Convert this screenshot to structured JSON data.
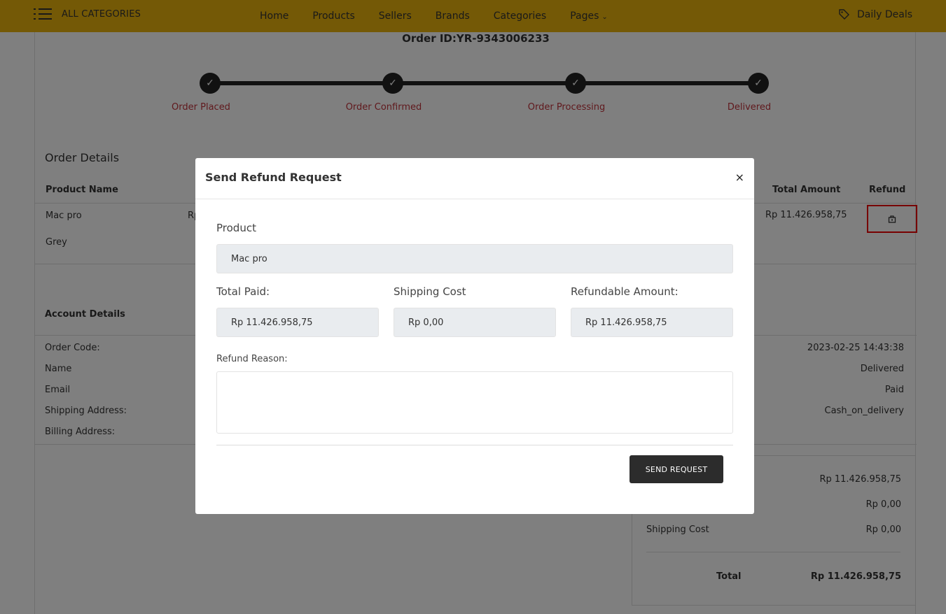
{
  "nav": {
    "categories_label": "ALL CATEGORIES",
    "menu": [
      "Home",
      "Products",
      "Sellers",
      "Brands",
      "Categories",
      "Pages"
    ],
    "daily_deals": "Daily Deals"
  },
  "order": {
    "id_text": "Order ID:YR-9343006233",
    "steps": [
      "Order Placed",
      "Order Confirmed",
      "Order Processing",
      "Delivered"
    ]
  },
  "order_details": {
    "title": "Order Details",
    "headers": {
      "product": "Product Name",
      "total": "Total Amount",
      "refund": "Refund"
    },
    "row": {
      "product": "Mac pro",
      "variant": "Grey",
      "price_fragment": "Rp",
      "total": "Rp 11.426.958,75"
    }
  },
  "account": {
    "title": "Account Details",
    "labels": [
      "Order Code:",
      "Name",
      "Email",
      "Shipping Address:",
      "Billing Address:"
    ],
    "values": [
      "2023-02-25 14:43:38",
      "Delivered",
      "Paid",
      "Cash_on_delivery"
    ]
  },
  "summary": {
    "values": [
      "Rp 11.426.958,75",
      "Rp 0,00"
    ],
    "shipping_label": "Shipping Cost",
    "shipping_value": "Rp 0,00",
    "total_label": "Total",
    "total_value": "Rp 11.426.958,75"
  },
  "modal": {
    "title": "Send Refund Request",
    "close": "×",
    "product_label": "Product",
    "product_value": "Mac pro",
    "total_paid_label": "Total Paid:",
    "total_paid_value": "Rp 11.426.958,75",
    "shipping_label": "Shipping Cost",
    "shipping_value": "Rp 0,00",
    "refundable_label": "Refundable Amount:",
    "refundable_value": "Rp 11.426.958,75",
    "reason_label": "Refund Reason:",
    "reason_value": "",
    "send_button": "SEND REQUEST"
  },
  "colors": {
    "nav_bg": "#e8b20c",
    "step_label": "#c0323b",
    "highlight": "#ee0000",
    "button": "#2c2c2c"
  },
  "icons": [
    "list-icon",
    "tag-icon",
    "check-icon",
    "refund-icon",
    "chevron-down-icon"
  ]
}
